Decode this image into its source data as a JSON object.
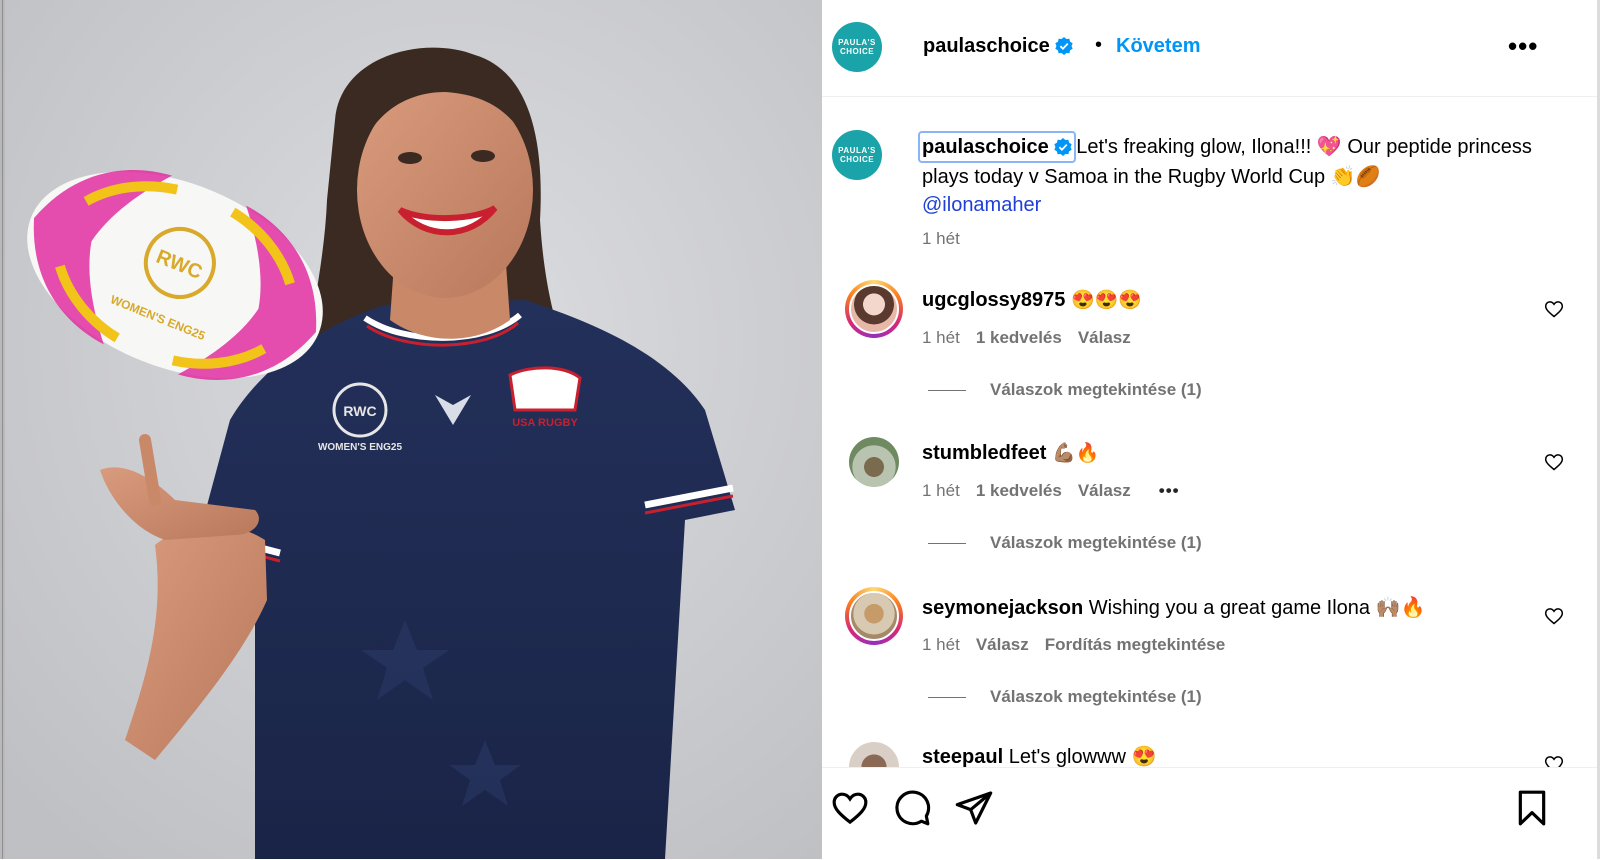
{
  "post": {
    "photo_alt": "USA rugby player tossing a rugby ball",
    "ball_text": "WOMEN'S ENG25",
    "ball_logo": "RWC",
    "jersey_text": "USA RUGBY",
    "jersey_badge": "WOMEN'S ENG25"
  },
  "header": {
    "brand_line1": "PAULA'S",
    "brand_line2": "CHOICE",
    "username": "paulaschoice",
    "separator": "•",
    "follow_label": "Követem",
    "more_label": "•••"
  },
  "caption": {
    "username": "paulaschoice",
    "text_part1": "Let's freaking glow, Ilona!!! 💖 Our peptide princess plays today v Samoa in the Rugby World Cup 👏🏉",
    "mention": "@ilonamaher",
    "time": "1 hét"
  },
  "comments": [
    {
      "username": "ugcglossy8975",
      "text": "😍😍😍",
      "time": "1 hét",
      "likes": "1 kedvelés",
      "reply": "Válasz",
      "extra": "",
      "view_replies": "Válaszok megtekintése (1)"
    },
    {
      "username": "stumbledfeet",
      "text": "💪🏽🔥",
      "time": "1 hét",
      "likes": "1 kedvelés",
      "reply": "Válasz",
      "extra": "•••",
      "view_replies": "Válaszok megtekintése (1)"
    },
    {
      "username": "seymonejackson",
      "text": "Wishing you a great game Ilona 🙌🏽🔥",
      "time": "1 hét",
      "likes": "",
      "reply": "Válasz",
      "extra": "Fordítás megtekintése",
      "view_replies": "Válaszok megtekintése (1)"
    },
    {
      "username": "steepaul",
      "text": "Let's glowww 😍"
    }
  ],
  "actions": {
    "like_icon": "heart-icon",
    "comment_icon": "comment-icon",
    "share_icon": "share-icon",
    "save_icon": "bookmark-icon"
  },
  "colors": {
    "brand_teal": "#1aa3a8",
    "link_blue": "#0095f6",
    "mention_blue": "#1e3fd6",
    "meta_gray": "#737373"
  }
}
